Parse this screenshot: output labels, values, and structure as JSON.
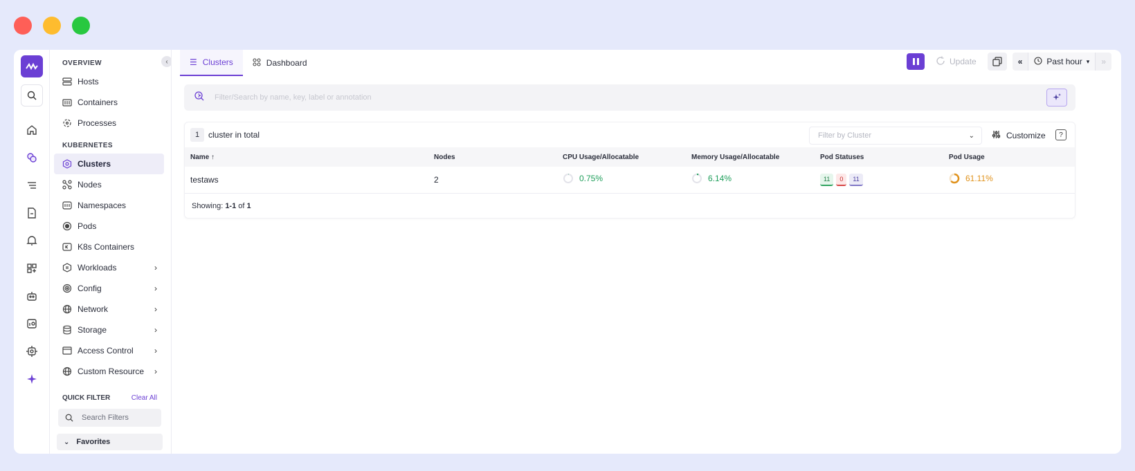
{
  "window_controls": [
    "close",
    "minimize",
    "maximize"
  ],
  "rail": {
    "icons": [
      "home-icon",
      "clusters-icon",
      "logs-icon",
      "document-icon",
      "alert-icon",
      "dashboard-add-icon",
      "bot-icon",
      "user-chart-icon",
      "settings-chip-icon",
      "sparkle-icon"
    ]
  },
  "sidebar": {
    "overview_title": "OVERVIEW",
    "overview_items": [
      {
        "label": "Hosts"
      },
      {
        "label": "Containers"
      },
      {
        "label": "Processes"
      }
    ],
    "kubernetes_title": "KUBERNETES",
    "kubernetes_items": [
      {
        "label": "Clusters"
      },
      {
        "label": "Nodes"
      },
      {
        "label": "Namespaces"
      },
      {
        "label": "Pods"
      },
      {
        "label": "K8s Containers"
      },
      {
        "label": "Workloads"
      },
      {
        "label": "Config"
      },
      {
        "label": "Network"
      },
      {
        "label": "Storage"
      },
      {
        "label": "Access Control"
      },
      {
        "label": "Custom Resource"
      }
    ],
    "quick_filter_title": "QUICK FILTER",
    "clear_all": "Clear All",
    "search_filters_placeholder": "Search Filters",
    "favorites": "Favorites"
  },
  "topbar": {
    "tabs": [
      {
        "label": "Clusters"
      },
      {
        "label": "Dashboard"
      }
    ],
    "update_label": "Update",
    "time_range": "Past hour"
  },
  "filter": {
    "placeholder": "Filter/Search by name, key, label or annotation"
  },
  "summary": {
    "count": "1",
    "count_text": "cluster in total",
    "filter_by_cluster": "Filter by Cluster",
    "customize": "Customize",
    "help": "?"
  },
  "table": {
    "headers": [
      "Name",
      "Nodes",
      "CPU Usage/Allocatable",
      "Memory Usage/Allocatable",
      "Pod Statuses",
      "Pod Usage"
    ],
    "rows": [
      {
        "name": "testaws",
        "nodes": "2",
        "cpu": "0.75%",
        "memory": "6.14%",
        "pod_statuses": [
          "11",
          "0",
          "11"
        ],
        "pod_usage": "61.11%"
      }
    ]
  },
  "pagination": {
    "prefix": "Showing: ",
    "range": "1-1",
    "of": " of ",
    "total": "1"
  },
  "colors": {
    "accent": "#6b3fd4",
    "green": "#1e9e5a",
    "orange": "#e0921c",
    "red": "#c62828"
  }
}
